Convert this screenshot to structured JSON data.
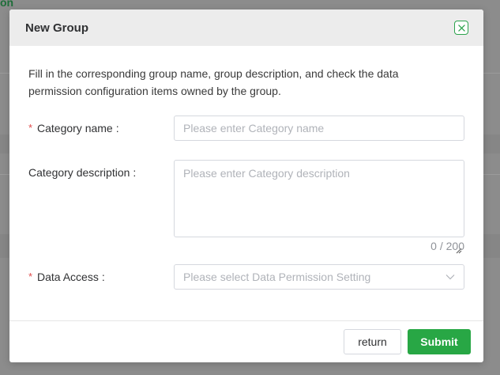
{
  "background": {
    "link_fragment": "on"
  },
  "dialog": {
    "title": "New Group",
    "intro": "Fill in the corresponding group name, group description, and check the data permission configuration items owned by the group.",
    "fields": {
      "category_name": {
        "required_mark": "*",
        "label": "Category name",
        "colon": ":",
        "value": "",
        "placeholder": "Please enter Category name"
      },
      "category_description": {
        "label": "Category description",
        "colon": ":",
        "value": "",
        "placeholder": "Please enter Category description",
        "counter": "0 / 200"
      },
      "data_access": {
        "required_mark": "*",
        "label": "Data Access",
        "colon": ":",
        "placeholder": "Please select Data Permission Setting"
      }
    },
    "buttons": {
      "return_label": "return",
      "submit_label": "Submit"
    }
  },
  "colors": {
    "primary": "#28a745",
    "required": "#e04b4b",
    "header_bg": "#ececec",
    "overlay": "#8c8c8c"
  },
  "icons": {
    "close": "close-icon",
    "dropdown": "chevron-down-icon",
    "resize": "resize-handle-icon"
  }
}
